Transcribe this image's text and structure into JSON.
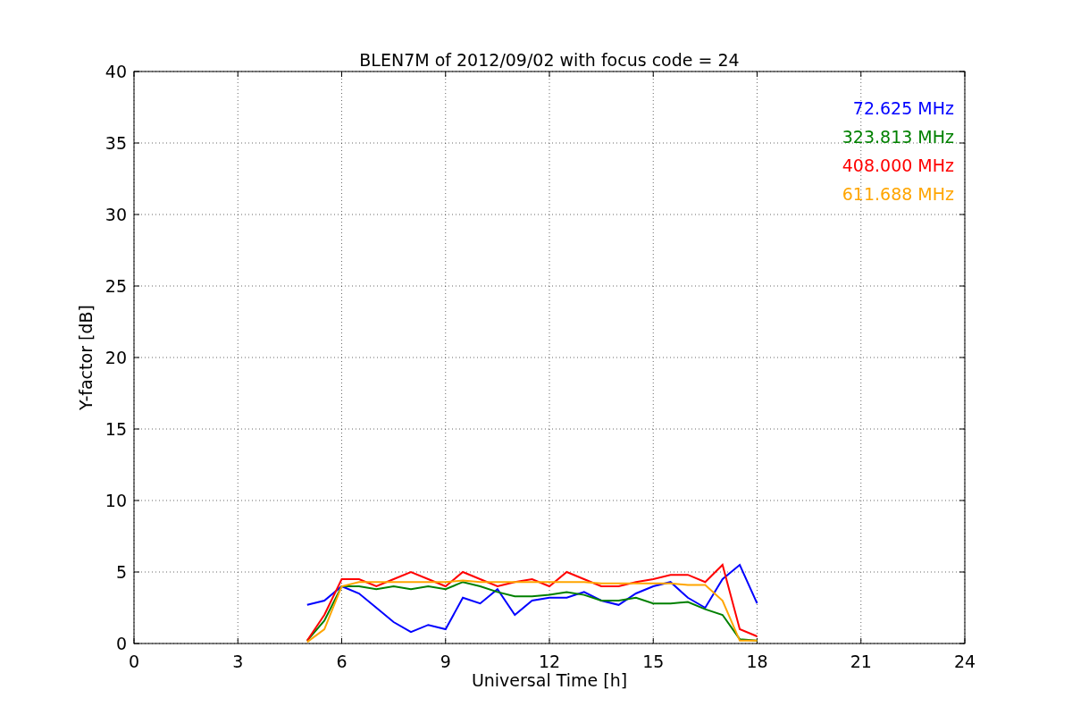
{
  "chart_data": {
    "type": "line",
    "title": "BLEN7M of 2012/09/02 with focus code = 24",
    "xlabel": "Universal Time [h]",
    "ylabel": "Y-factor [dB]",
    "x": [
      5.0,
      5.5,
      6.0,
      6.5,
      7.0,
      7.5,
      8.0,
      8.5,
      9.0,
      9.5,
      10.0,
      10.5,
      11.0,
      11.5,
      12.0,
      12.5,
      13.0,
      13.5,
      14.0,
      14.5,
      15.0,
      15.5,
      16.0,
      16.5,
      17.0,
      17.5,
      18.0
    ],
    "series": [
      {
        "name": "72.625 MHz",
        "color": "#0000ff",
        "values": [
          2.7,
          3.0,
          4.0,
          3.5,
          2.5,
          1.5,
          0.8,
          1.3,
          1.0,
          3.2,
          2.8,
          3.8,
          2.0,
          3.0,
          3.2,
          3.2,
          3.6,
          3.0,
          2.7,
          3.5,
          4.0,
          4.3,
          3.2,
          2.5,
          4.5,
          5.5,
          2.8
        ]
      },
      {
        "name": "323.813 MHz",
        "color": "#008000",
        "values": [
          0.2,
          1.6,
          4.0,
          4.0,
          3.8,
          4.0,
          3.8,
          4.0,
          3.8,
          4.3,
          4.0,
          3.6,
          3.3,
          3.3,
          3.4,
          3.6,
          3.4,
          3.0,
          3.0,
          3.2,
          2.8,
          2.8,
          2.9,
          2.4,
          2.0,
          0.3,
          0.2
        ]
      },
      {
        "name": "408.000 MHz",
        "color": "#ff0000",
        "values": [
          0.2,
          2.0,
          4.5,
          4.5,
          4.0,
          4.5,
          5.0,
          4.5,
          4.0,
          5.0,
          4.5,
          4.0,
          4.3,
          4.5,
          4.0,
          5.0,
          4.5,
          4.0,
          4.0,
          4.3,
          4.5,
          4.8,
          4.8,
          4.3,
          5.5,
          1.0,
          0.5
        ]
      },
      {
        "name": "611.688 MHz",
        "color": "#ffa500",
        "values": [
          0.1,
          1.0,
          4.0,
          4.3,
          4.3,
          4.3,
          4.3,
          4.3,
          4.3,
          4.4,
          4.3,
          4.3,
          4.3,
          4.3,
          4.3,
          4.3,
          4.3,
          4.2,
          4.2,
          4.2,
          4.2,
          4.2,
          4.1,
          4.1,
          3.0,
          0.2,
          0.2
        ]
      }
    ],
    "xlim": [
      0,
      24
    ],
    "ylim": [
      0,
      40
    ],
    "xticks": [
      0,
      3,
      6,
      9,
      12,
      15,
      18,
      21,
      24
    ],
    "yticks": [
      0,
      5,
      10,
      15,
      20,
      25,
      30,
      35,
      40
    ],
    "grid": true
  }
}
